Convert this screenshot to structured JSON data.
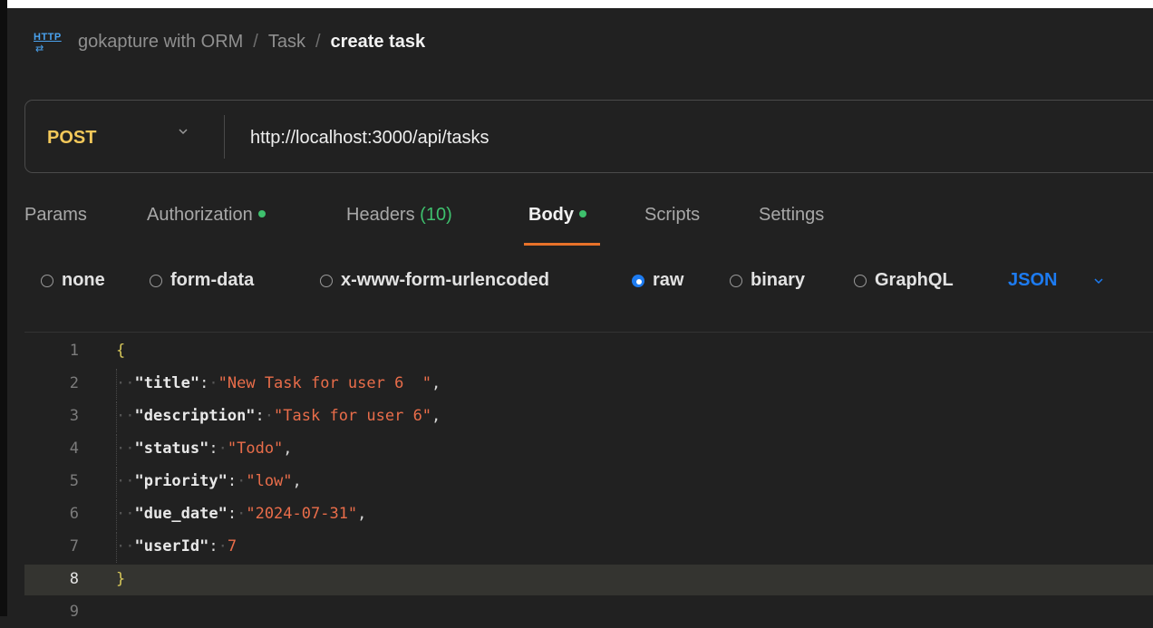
{
  "breadcrumb": {
    "icon": "http-icon",
    "items": [
      "gokapture with ORM",
      "Task"
    ],
    "separator": "/",
    "current": "create task"
  },
  "request": {
    "method": "POST",
    "url": "http://localhost:3000/api/tasks"
  },
  "tabs": [
    {
      "label": "Params"
    },
    {
      "label": "Authorization",
      "dot": true
    },
    {
      "label": "Headers",
      "count": "(10)"
    },
    {
      "label": "Body",
      "dot": true,
      "active": true
    },
    {
      "label": "Scripts"
    },
    {
      "label": "Settings"
    }
  ],
  "body_types": {
    "options": [
      "none",
      "form-data",
      "x-www-form-urlencoded",
      "raw",
      "binary",
      "GraphQL"
    ],
    "selected": "raw",
    "format": "JSON"
  },
  "editor": {
    "line_numbers": [
      "1",
      "2",
      "3",
      "4",
      "5",
      "6",
      "7",
      "8",
      "9"
    ],
    "current_line": "8",
    "lines": [
      {
        "brace": "{"
      },
      {
        "key": "\"title\"",
        "value": "\"New Task for user 6  \"",
        "comma": ","
      },
      {
        "key": "\"description\"",
        "value": "\"Task for user 6\"",
        "comma": ","
      },
      {
        "key": "\"status\"",
        "value": "\"Todo\"",
        "comma": ","
      },
      {
        "key": "\"priority\"",
        "value": "\"low\"",
        "comma": ","
      },
      {
        "key": "\"due_date\"",
        "value": "\"2024-07-31\"",
        "comma": ","
      },
      {
        "key": "\"userId\"",
        "value": "7",
        "comma": ""
      },
      {
        "brace": "}"
      }
    ]
  },
  "colors": {
    "method": "#f3c85a",
    "accent": "#e8722a",
    "dot": "#3ec06d",
    "link": "#1d7bf0",
    "string": "#e96d4a"
  }
}
